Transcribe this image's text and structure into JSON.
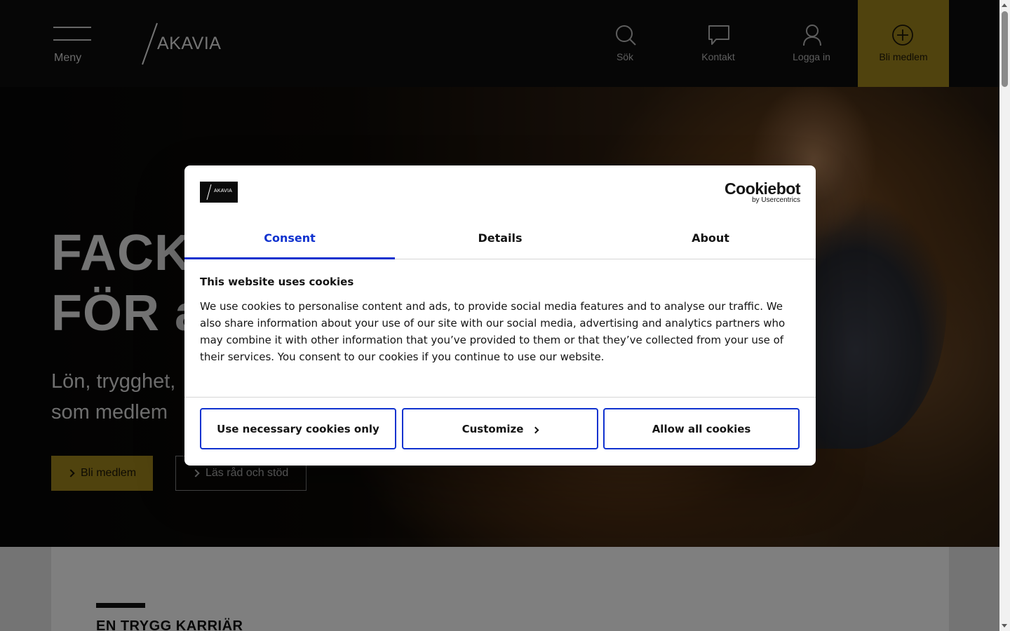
{
  "header": {
    "menu_label": "Meny",
    "logo_text": "AKAVIA",
    "nav": [
      {
        "label": "Sök",
        "icon": "search-icon"
      },
      {
        "label": "Kontakt",
        "icon": "chat-icon"
      },
      {
        "label": "Logga in",
        "icon": "user-icon"
      },
      {
        "label": "Bli medlem",
        "icon": "plus-circle-icon"
      }
    ]
  },
  "hero": {
    "title": "FACK\nFÖR a",
    "subtitle": "Lön, trygghet,\nsom medlem",
    "primary_button": "Bli medlem",
    "secondary_button": "Läs råd och stöd"
  },
  "section": {
    "title": "EN TRYGG KARRIÄR"
  },
  "cookie_dialog": {
    "logo_text": "AKAVIA",
    "provider_name": "Cookiebot",
    "provider_by": "by Usercentrics",
    "tabs": [
      {
        "label": "Consent",
        "active": true
      },
      {
        "label": "Details",
        "active": false
      },
      {
        "label": "About",
        "active": false
      }
    ],
    "heading": "This website uses cookies",
    "body": "We use cookies to personalise content and ads, to provide social media features and to analyse our traffic. We also share information about your use of our site with our social media, advertising and analytics partners who may combine it with other information that you’ve provided to them or that they’ve collected from your use of their services. You consent to our cookies if you continue to use our website.",
    "buttons": {
      "necessary": "Use necessary cookies only",
      "customize": "Customize",
      "allow_all": "Allow all cookies"
    }
  },
  "colors": {
    "accent_gold": "#a0861c",
    "dialog_accent_blue": "#1032cf",
    "header_bg": "#0c0c0c"
  }
}
